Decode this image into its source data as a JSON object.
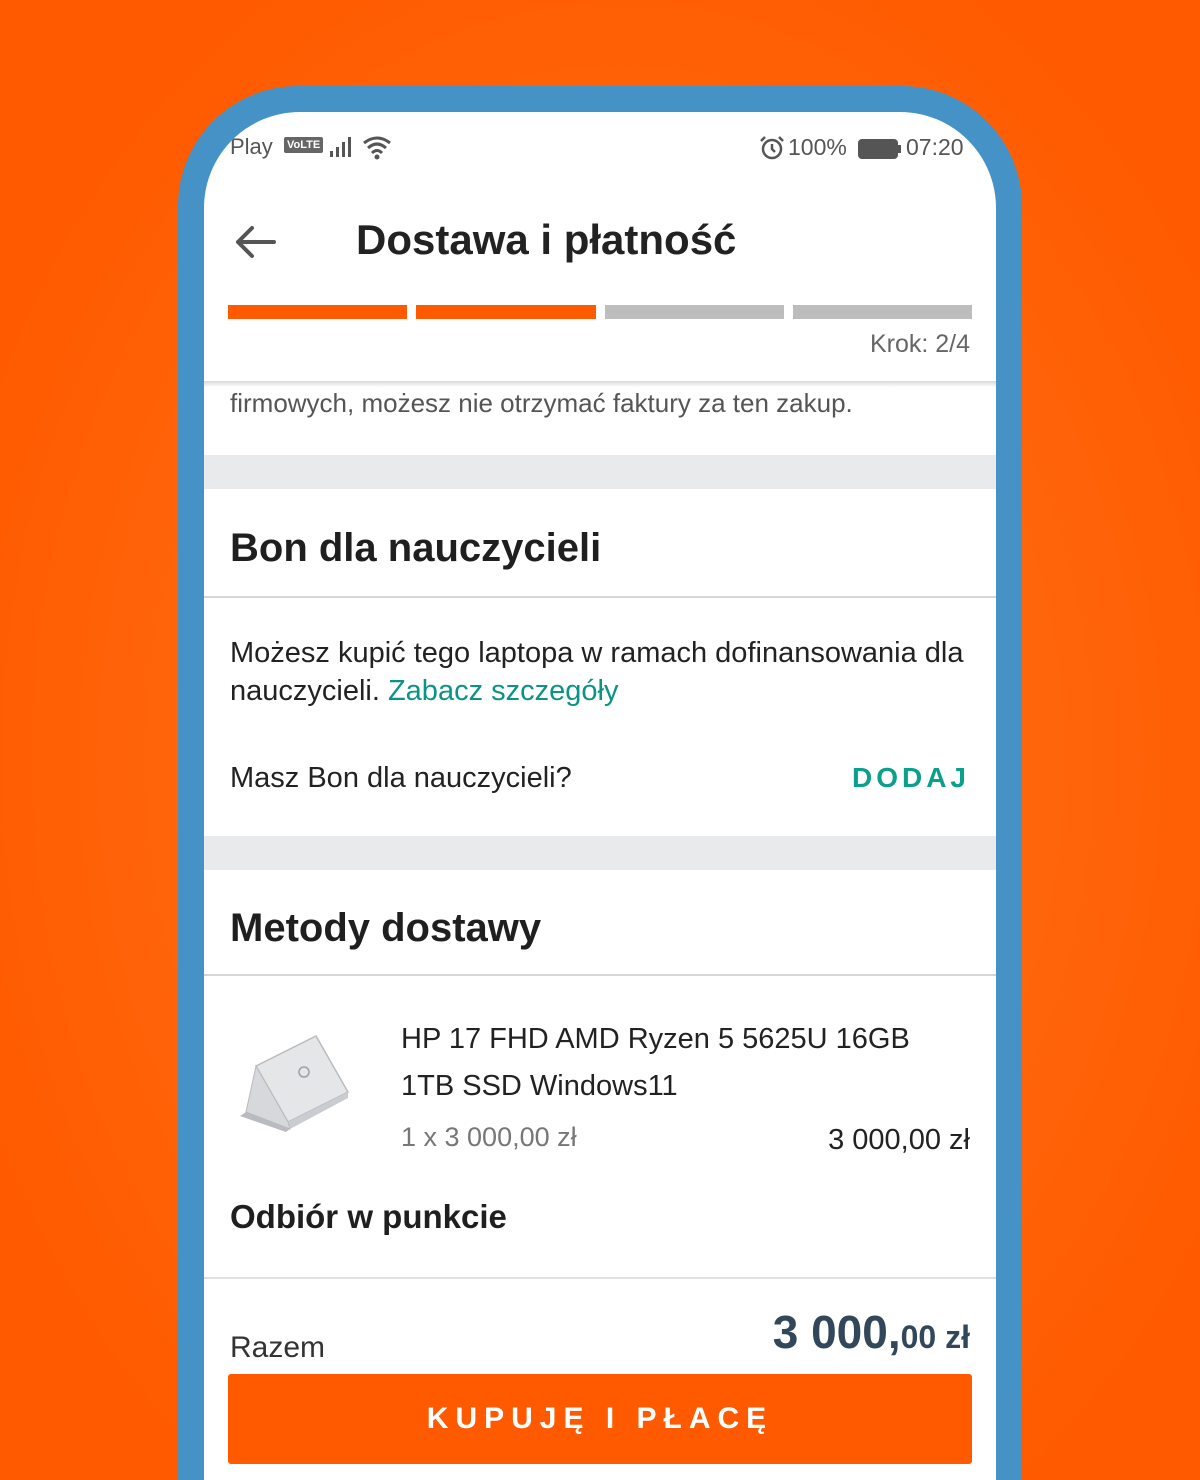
{
  "status_bar": {
    "carrier": "Play",
    "volte": "VoLTE",
    "battery": "100%",
    "time": "07:20"
  },
  "header": {
    "title": "Dostawa i płatność",
    "step": "Krok: 2/4",
    "progress_steps_total": 4,
    "progress_steps_done": 2
  },
  "notice_tail": "firmowych, możesz nie otrzymać faktury za ten zakup.",
  "teacher_voucher": {
    "title": "Bon dla nauczycieli",
    "description": "Możesz kupić tego laptopa w ramach dofinansowania dla nauczycieli.",
    "link": "Zabacz szczegóły",
    "question": "Masz Bon dla nauczycieli?",
    "add_label": "DODAJ"
  },
  "delivery": {
    "title": "Metody dostawy",
    "product": {
      "name": "HP 17 FHD AMD Ryzen 5 5625U 16GB 1TB SSD Windows11",
      "quantity_price": "1 x 3 000,00 zł",
      "price": "3 000,00 zł"
    },
    "pickup_title": "Odbiór w punkcie"
  },
  "footer": {
    "total_label": "Razem",
    "total_integer": "3 000,",
    "total_decimal": "00 zł",
    "buy_button": "KUPUJĘ I PŁACĘ"
  },
  "colors": {
    "accent": "#ff5a00",
    "link": "#0a9484",
    "frame": "#4592c6",
    "total": "#33475b"
  }
}
